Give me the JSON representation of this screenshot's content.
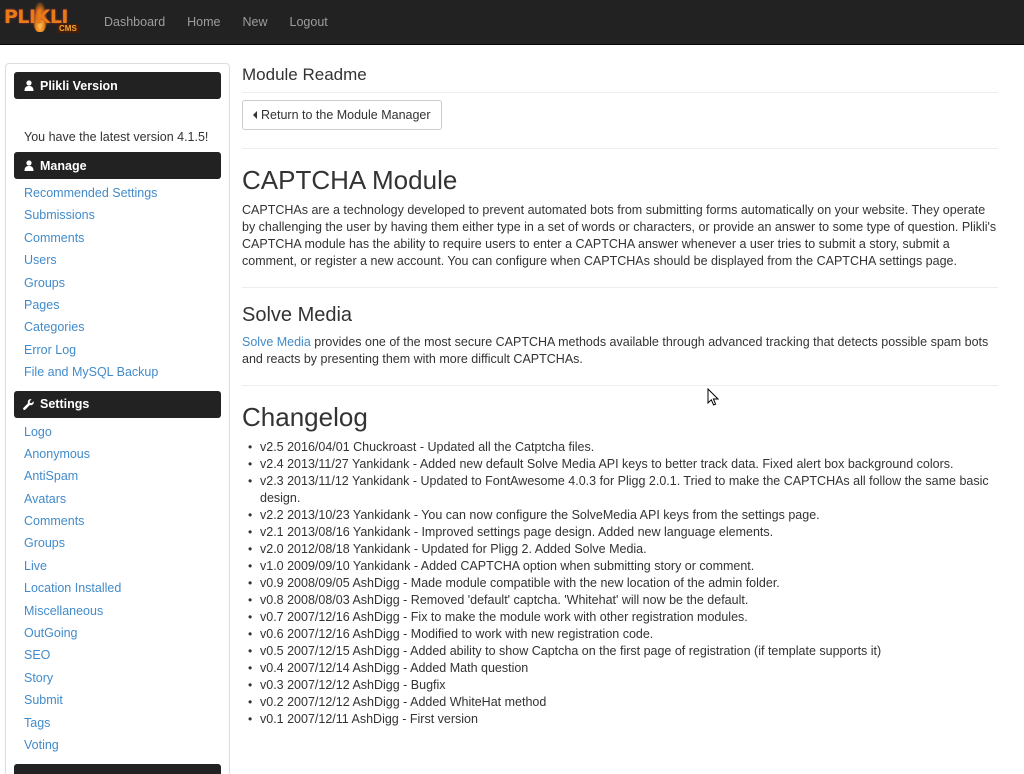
{
  "brand": {
    "name": "PLIKLI",
    "sub": "CMS"
  },
  "nav": {
    "items": [
      "Dashboard",
      "Home",
      "New",
      "Logout"
    ]
  },
  "sidebar": {
    "version_panel": {
      "title": "Plikli Version",
      "text": "You have the latest version 4.1.5!"
    },
    "manage_panel": {
      "title": "Manage",
      "items": [
        "Recommended Settings",
        "Submissions",
        "Comments",
        "Users",
        "Groups",
        "Pages",
        "Categories",
        "Error Log",
        "File and MySQL Backup"
      ]
    },
    "settings_panel": {
      "title": "Settings",
      "items": [
        "Logo",
        "Anonymous",
        "AntiSpam",
        "Avatars",
        "Comments",
        "Groups",
        "Live",
        "Location Installed",
        "Miscellaneous",
        "OutGoing",
        "SEO",
        "Story",
        "Submit",
        "Tags",
        "Voting"
      ]
    }
  },
  "main": {
    "page_title": "Module Readme",
    "return_button": "Return to the Module Manager",
    "captcha_title": "CAPTCHA Module",
    "captcha_text": "CAPTCHAs are a technology developed to prevent automated bots from submitting forms automatically on your website. They operate by challenging the user by having them either type in a set of words or characters, or provide an answer to some type of question. Plikli's CAPTCHA module has the ability to require users to enter a CAPTCHA answer whenever a user tries to submit a story, submit a comment, or register a new account. You can configure when CAPTCHAs should be displayed from the CAPTCHA settings page.",
    "solve_title": "Solve Media",
    "solve_link": "Solve Media",
    "solve_text": " provides one of the most secure CAPTCHA methods available through advanced tracking that detects possible spam bots and reacts by presenting them with more difficult CAPTCHAs.",
    "changelog_title": "Changelog",
    "changelog": [
      "v2.5 2016/04/01 Chuckroast - Updated all the Catptcha files.",
      "v2.4 2013/11/27 Yankidank - Added new default Solve Media API keys to better track data. Fixed alert box background colors.",
      "v2.3 2013/11/12 Yankidank - Updated to FontAwesome 4.0.3 for Pligg 2.0.1. Tried to make the CAPTCHAs all follow the same basic design.",
      "v2.2 2013/10/23 Yankidank - You can now configure the SolveMedia API keys from the settings page.",
      "v2.1 2013/08/16 Yankidank - Improved settings page design. Added new language elements.",
      "v2.0 2012/08/18 Yankidank - Updated for Pligg 2. Added Solve Media.",
      "v1.0 2009/09/10 Yankidank - Added CAPTCHA option when submitting story or comment.",
      "v0.9 2008/09/05 AshDigg - Made module compatible with the new location of the admin folder.",
      "v0.8 2008/08/03 AshDigg - Removed 'default' captcha. 'Whitehat' will now be the default.",
      "v0.7 2007/12/16 AshDigg - Fix to make the module work with other registration modules.",
      "v0.6 2007/12/16 AshDigg - Modified to work with new registration code.",
      "v0.5 2007/12/15 AshDigg - Added ability to show Captcha on the first page of registration (if template supports it)",
      "v0.4 2007/12/14 AshDigg - Added Math question",
      "v0.3 2007/12/12 AshDigg - Bugfix",
      "v0.2 2007/12/12 AshDigg - Added WhiteHat method",
      "v0.1 2007/12/11 AshDigg - First version"
    ]
  },
  "colors": {
    "navbar": "#222222",
    "link": "#428bca",
    "brand": "#e87a17"
  }
}
